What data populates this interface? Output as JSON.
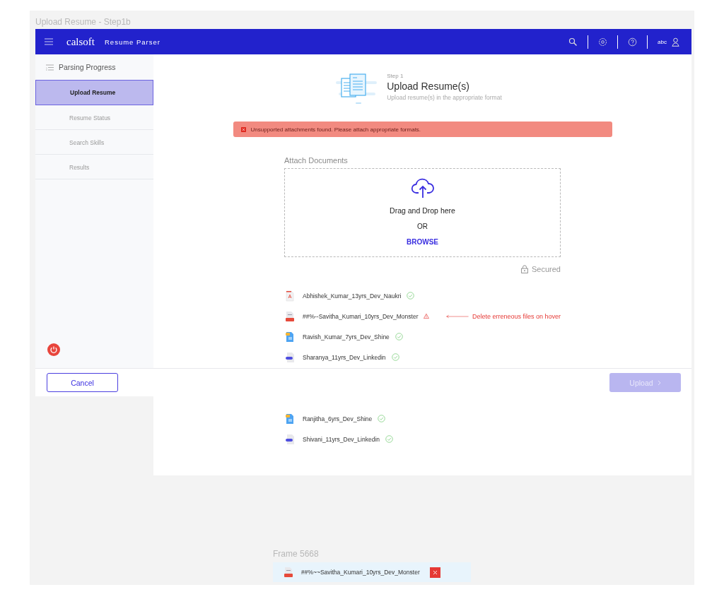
{
  "frame_title": "Upload Resume - Step1b",
  "header": {
    "logo": "calsoft",
    "app_name": "Resume Parser",
    "user": "abc"
  },
  "sidebar": {
    "title": "Parsing Progress",
    "items": [
      {
        "label": "Upload Resume",
        "selected": true
      },
      {
        "label": "Resume Status",
        "selected": false
      },
      {
        "label": "Search Skills",
        "selected": false
      },
      {
        "label": "Results",
        "selected": false
      }
    ]
  },
  "step": {
    "label": "Step 1",
    "title": "Upload Resume(s)",
    "subtitle": "Upload resume(s) in the appropriate format"
  },
  "alert": {
    "message": "Unsupported attachments found. Please attach appropriate formats."
  },
  "attach": {
    "label": "Attach Documents",
    "drop_text": "Drag and Drop here",
    "or_text": "OR",
    "browse": "BROWSE",
    "secured": "Secured"
  },
  "files": [
    {
      "name": "Abhishek_Kumar_13yrs_Dev_Naukri",
      "kind": "pdf",
      "error": false
    },
    {
      "name": "##%--Savitha_Kumari_10yrs_Dev_Monster",
      "kind": "red",
      "error": true,
      "annotation": "Delete erreneous files on hover"
    },
    {
      "name": "Ravish_Kumar_7yrs_Dev_Shine",
      "kind": "image",
      "error": false
    },
    {
      "name": "Sharanya_11yrs_Dev_Linkedin",
      "kind": "doc",
      "error": false
    }
  ],
  "files_below": [
    {
      "name": "Ranjitha_6yrs_Dev_Shine",
      "kind": "image",
      "error": false
    },
    {
      "name": "Shivani_11yrs_Dev_Linkedin",
      "kind": "doc",
      "error": false
    }
  ],
  "footer": {
    "cancel": "Cancel",
    "upload": {
      "label": "Upload",
      "disabled": true
    }
  },
  "hover_frame": {
    "title": "Frame 5668",
    "file": {
      "name": "##%~~Savitha_Kumari_10yrs_Dev_Monster",
      "kind": "red"
    }
  }
}
